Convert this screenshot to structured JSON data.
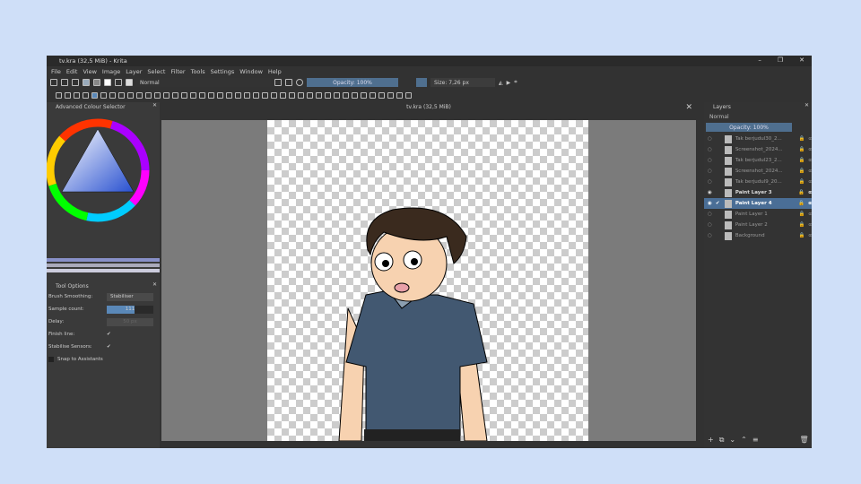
{
  "window": {
    "title": "tv.kra (32,5 MiB)  - Krita",
    "controls": [
      "–",
      "❐",
      "✕"
    ]
  },
  "menu": [
    "File",
    "Edit",
    "View",
    "Image",
    "Layer",
    "Select",
    "Filter",
    "Tools",
    "Settings",
    "Window",
    "Help"
  ],
  "toolbar": {
    "blend_mode": "Normal",
    "opacity": "Opacity: 100%",
    "size": "Size: 7,26 px"
  },
  "colour_selector": {
    "title": "Advanced Colour Selector"
  },
  "tool_options": {
    "title": "Tool Options",
    "brush_smoothing_label": "Brush Smoothing:",
    "brush_smoothing": "Stabiliser",
    "sample_count_label": "Sample count:",
    "sample_count": "111",
    "delay_label": "Delay:",
    "delay": "50 px",
    "finish_line_label": "Finish line:",
    "stabilise_label": "Stabilise Sensors:",
    "snap_label": "Snap to Assistants"
  },
  "canvas": {
    "tab_title": "tv.kra (32,5 MiB)"
  },
  "layers": {
    "title": "Layers",
    "blend_mode": "Normal",
    "opacity": "Opacity:  100%",
    "items": [
      {
        "name": "Tak berjudul30_2...",
        "visible": false,
        "selected": false
      },
      {
        "name": "Screenshot_2024...",
        "visible": false,
        "selected": false
      },
      {
        "name": "Tak berjudul23_2...",
        "visible": false,
        "selected": false
      },
      {
        "name": "Screenshot_2024...",
        "visible": false,
        "selected": false
      },
      {
        "name": "Tak berjudul9_20...",
        "visible": false,
        "selected": false
      },
      {
        "name": "Paint Layer 3",
        "visible": true,
        "selected": false
      },
      {
        "name": "Paint Layer 4",
        "visible": true,
        "selected": true
      },
      {
        "name": "Paint Layer 1",
        "visible": false,
        "selected": false
      },
      {
        "name": "Paint Layer 2",
        "visible": false,
        "selected": false
      },
      {
        "name": "Background",
        "visible": false,
        "selected": false
      }
    ]
  }
}
